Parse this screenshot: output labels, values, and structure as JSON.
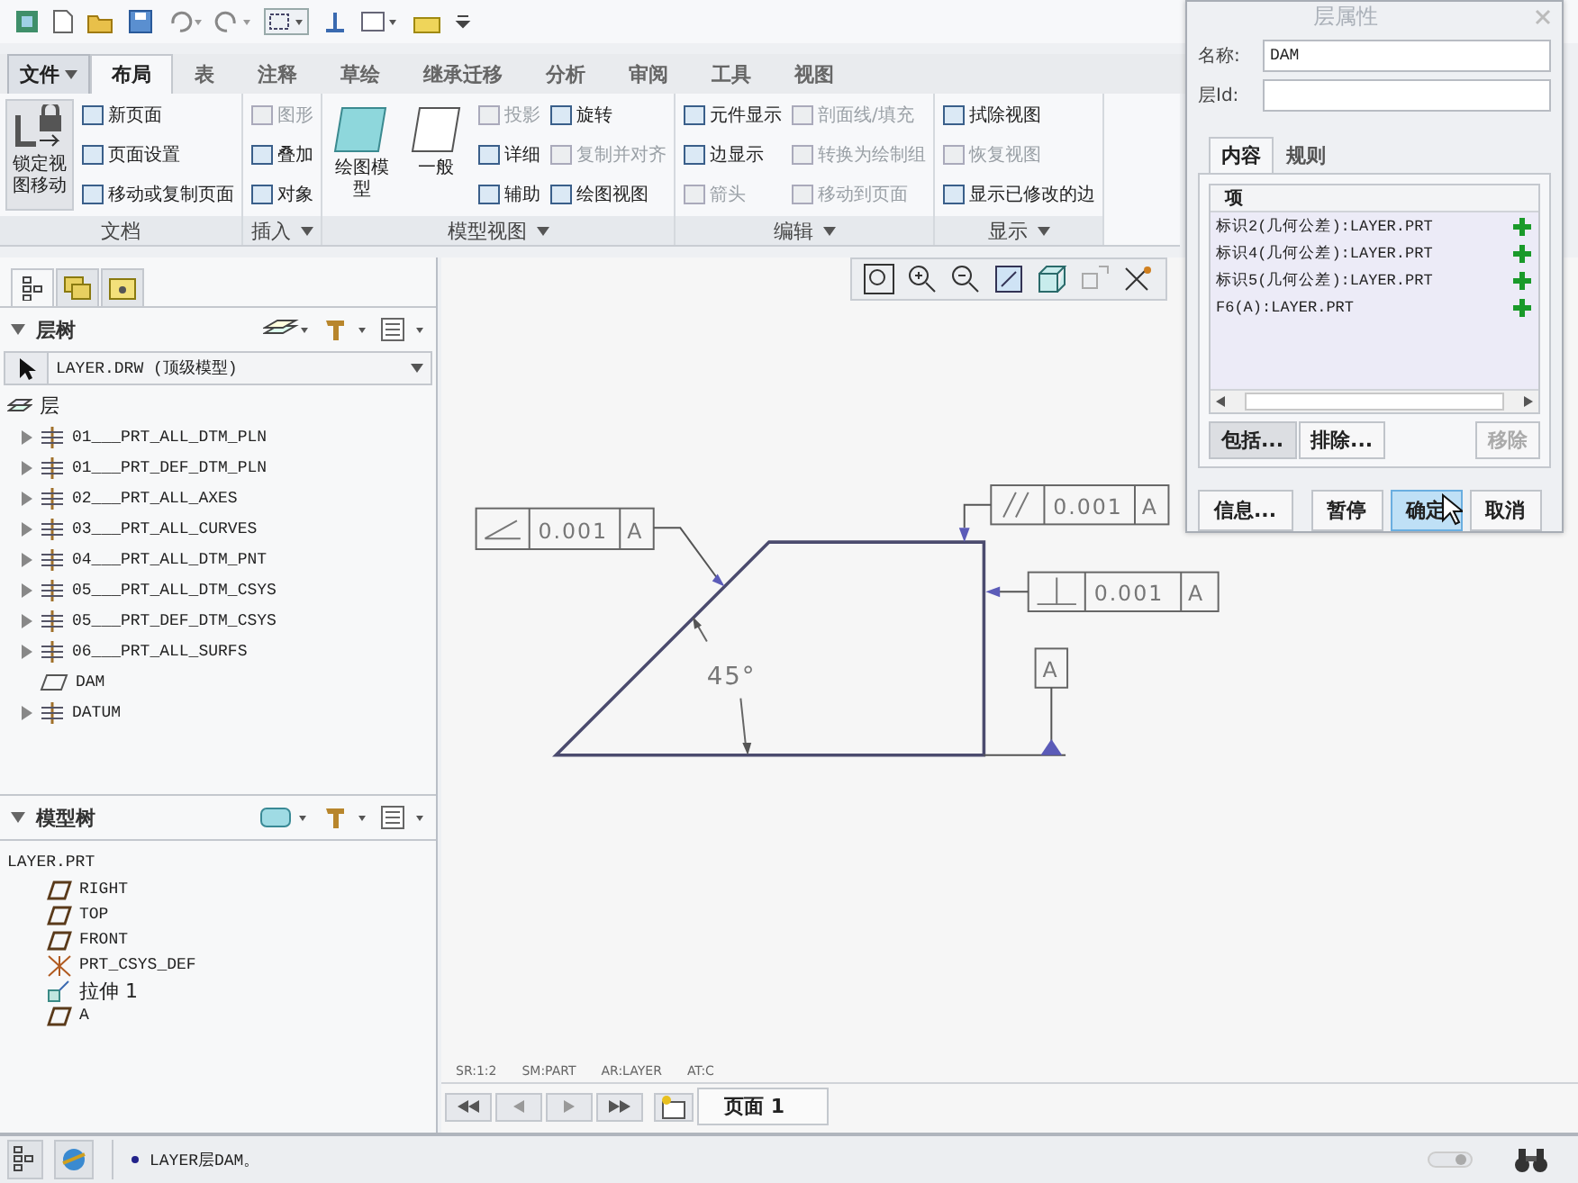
{
  "ribbon_tabs": [
    {
      "label": "文件",
      "kind": "menu",
      "selected": false
    },
    {
      "label": "布局",
      "kind": "tab",
      "selected": true
    },
    {
      "label": "表",
      "kind": "tab",
      "selected": false
    },
    {
      "label": "注释",
      "kind": "tab",
      "selected": false
    },
    {
      "label": "草绘",
      "kind": "tab",
      "selected": false
    },
    {
      "label": "继承迁移",
      "kind": "tab",
      "selected": false
    },
    {
      "label": "分析",
      "kind": "tab",
      "selected": false
    },
    {
      "label": "审阅",
      "kind": "tab",
      "selected": false
    },
    {
      "label": "工具",
      "kind": "tab",
      "selected": false
    },
    {
      "label": "视图",
      "kind": "tab",
      "selected": false
    }
  ],
  "ribbon_groups": [
    {
      "label": "文档",
      "menu": false,
      "large": [
        {
          "label": "锁定视图移动",
          "kind": "lock",
          "pressed": true
        }
      ],
      "columns": [
        [
          {
            "label": "新页面",
            "disabled": false
          },
          {
            "label": "页面设置",
            "disabled": false
          },
          {
            "label": "移动或复制页面",
            "disabled": false
          }
        ]
      ]
    },
    {
      "label": "插入",
      "menu": true,
      "columns": [
        [
          {
            "label": "图形",
            "disabled": true
          },
          {
            "label": "叠加",
            "disabled": false
          },
          {
            "label": "对象",
            "disabled": false
          }
        ]
      ]
    },
    {
      "label": "模型视图",
      "menu": true,
      "large": [
        {
          "label": "绘图模型",
          "kind": "cyan",
          "pressed": false
        },
        {
          "label": "一般",
          "kind": "white",
          "pressed": false
        }
      ],
      "columns": [
        [
          {
            "label": "投影",
            "disabled": true
          },
          {
            "label": "详细",
            "disabled": false
          },
          {
            "label": "辅助",
            "disabled": false
          }
        ],
        [
          {
            "label": "旋转",
            "disabled": false
          },
          {
            "label": "复制并对齐",
            "disabled": true
          },
          {
            "label": "绘图视图",
            "disabled": false
          }
        ]
      ]
    },
    {
      "label": "编辑",
      "menu": true,
      "columns": [
        [
          {
            "label": "元件显示",
            "disabled": false
          },
          {
            "label": "边显示",
            "disabled": false
          },
          {
            "label": "箭头",
            "disabled": true
          }
        ],
        [
          {
            "label": "剖面线/填充",
            "disabled": true
          },
          {
            "label": "转换为绘制组",
            "disabled": true
          },
          {
            "label": "移动到页面",
            "disabled": true
          }
        ]
      ]
    },
    {
      "label": "显示",
      "menu": true,
      "columns": [
        [
          {
            "label": "拭除视图",
            "disabled": false
          },
          {
            "label": "恢复视图",
            "disabled": true
          },
          {
            "label": "显示已修改的边",
            "disabled": false
          }
        ]
      ]
    }
  ],
  "layer_tree": {
    "title": "层树",
    "model": "LAYER.DRW (顶级模型)",
    "root": {
      "label": "层",
      "children": [
        {
          "label": "01___PRT_ALL_DTM_PLN",
          "kind": "layer"
        },
        {
          "label": "01___PRT_DEF_DTM_PLN",
          "kind": "layer"
        },
        {
          "label": "02___PRT_ALL_AXES",
          "kind": "layer"
        },
        {
          "label": "03___PRT_ALL_CURVES",
          "kind": "layer"
        },
        {
          "label": "04___PRT_ALL_DTM_PNT",
          "kind": "layer"
        },
        {
          "label": "05___PRT_ALL_DTM_CSYS",
          "kind": "layer"
        },
        {
          "label": "05___PRT_DEF_DTM_CSYS",
          "kind": "layer"
        },
        {
          "label": "06___PRT_ALL_SURFS",
          "kind": "layer"
        },
        {
          "label": "DAM",
          "kind": "item"
        },
        {
          "label": "DATUM",
          "kind": "layer"
        }
      ]
    }
  },
  "model_tree": {
    "title": "模型树",
    "root": {
      "label": "LAYER.PRT",
      "children": [
        {
          "label": "RIGHT",
          "kind": "plane"
        },
        {
          "label": "TOP",
          "kind": "plane"
        },
        {
          "label": "FRONT",
          "kind": "plane"
        },
        {
          "label": "PRT_CSYS_DEF",
          "kind": "csys"
        },
        {
          "label": "拉伸 1",
          "kind": "extrude"
        },
        {
          "label": "A",
          "kind": "plane"
        }
      ]
    }
  },
  "drawing": {
    "frames": [
      {
        "kind": "angularity",
        "tolerance": "0.001",
        "datum": "A"
      },
      {
        "kind": "parallelism",
        "tolerance": "0.001",
        "datum": "A"
      },
      {
        "kind": "perpendicularity",
        "tolerance": "0.001",
        "datum": "A"
      }
    ],
    "angle": "45°",
    "datum_label": "A",
    "info": [
      "SR:1:2",
      "SM:PART",
      "AR:LAYER",
      "AT:C"
    ]
  },
  "page_tab": "页面 1",
  "status_message": "LAYER层DAM。",
  "dialog": {
    "title": "层属性",
    "fields": [
      {
        "label": "名称:",
        "value": "DAM"
      },
      {
        "label": "层Id:"
      }
    ],
    "tabs": [
      {
        "label": "内容",
        "selected": true
      },
      {
        "label": "规则",
        "selected": false
      }
    ],
    "list_header": "项",
    "items": [
      {
        "label": "标识2(几何公差):LAYER.PRT"
      },
      {
        "label": "标识4(几何公差):LAYER.PRT"
      },
      {
        "label": "标识5(几何公差):LAYER.PRT"
      },
      {
        "label": "F6(A):LAYER.PRT"
      }
    ],
    "list_buttons": [
      {
        "label": "包括...",
        "pressed": true,
        "disabled": false
      },
      {
        "label": "排除...",
        "pressed": false,
        "disabled": false
      },
      {
        "label": "移除",
        "pressed": false,
        "disabled": true
      }
    ],
    "actions": [
      {
        "label": "信息...",
        "hover": false
      },
      {
        "label": "暂停",
        "hover": false
      },
      {
        "label": "确定",
        "hover": true
      },
      {
        "label": "取消",
        "hover": false
      }
    ]
  }
}
